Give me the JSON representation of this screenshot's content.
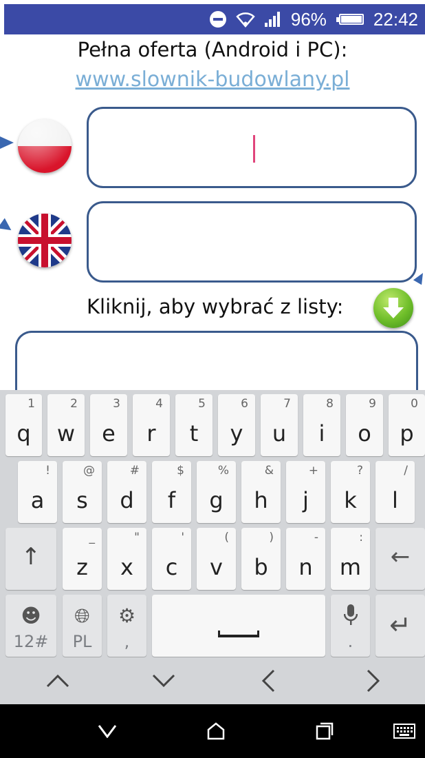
{
  "status_bar": {
    "battery": "96%",
    "time": "22:42",
    "icons": [
      "do-not-disturb-icon",
      "wifi-icon",
      "signal-icon",
      "battery-icon"
    ]
  },
  "header": {
    "title": "Pełna oferta (Android i PC):",
    "link": "www.slownik-budowlany.pl"
  },
  "fields": {
    "polish": {
      "flag": "poland-flag-icon",
      "value": ""
    },
    "english": {
      "flag": "uk-flag-icon",
      "value": ""
    }
  },
  "picker": {
    "label": "Kliknij, aby wybrać z listy:",
    "button_icon": "green-down-arrow-icon"
  },
  "keyboard": {
    "row1": [
      {
        "key": "q",
        "alt": "1"
      },
      {
        "key": "w",
        "alt": "2"
      },
      {
        "key": "e",
        "alt": "3"
      },
      {
        "key": "r",
        "alt": "4"
      },
      {
        "key": "t",
        "alt": "5"
      },
      {
        "key": "y",
        "alt": "6"
      },
      {
        "key": "u",
        "alt": "7"
      },
      {
        "key": "i",
        "alt": "8"
      },
      {
        "key": "o",
        "alt": "9"
      },
      {
        "key": "p",
        "alt": "0"
      }
    ],
    "row2": [
      {
        "key": "a",
        "alt": "!"
      },
      {
        "key": "s",
        "alt": "@"
      },
      {
        "key": "d",
        "alt": "#"
      },
      {
        "key": "f",
        "alt": "$"
      },
      {
        "key": "g",
        "alt": "%"
      },
      {
        "key": "h",
        "alt": "&"
      },
      {
        "key": "j",
        "alt": "+"
      },
      {
        "key": "k",
        "alt": "?"
      },
      {
        "key": "l",
        "alt": "/"
      }
    ],
    "row3": [
      {
        "key": "z",
        "alt": "_"
      },
      {
        "key": "x",
        "alt": "\""
      },
      {
        "key": "c",
        "alt": "'"
      },
      {
        "key": "v",
        "alt": "("
      },
      {
        "key": "b",
        "alt": ")"
      },
      {
        "key": "n",
        "alt": "-"
      },
      {
        "key": "m",
        "alt": ":"
      }
    ],
    "shift_icon": "shift-up-arrow-icon",
    "backspace_icon": "backspace-arrow-icon",
    "bottom": {
      "symbols_label": "12#",
      "language_label": "PL",
      "comma_label": ",",
      "period_label": ".",
      "emoji_icon": "emoji-icon",
      "globe_icon": "globe-icon",
      "settings_icon": "settings-gear-icon",
      "mic_icon": "microphone-icon",
      "enter_icon": "enter-return-icon"
    },
    "nav": [
      "chevron-up-icon",
      "chevron-down-icon",
      "chevron-left-icon",
      "chevron-right-icon"
    ]
  },
  "system_bar": [
    "back-icon",
    "home-icon",
    "recents-icon",
    "keyboard-switch-icon"
  ]
}
